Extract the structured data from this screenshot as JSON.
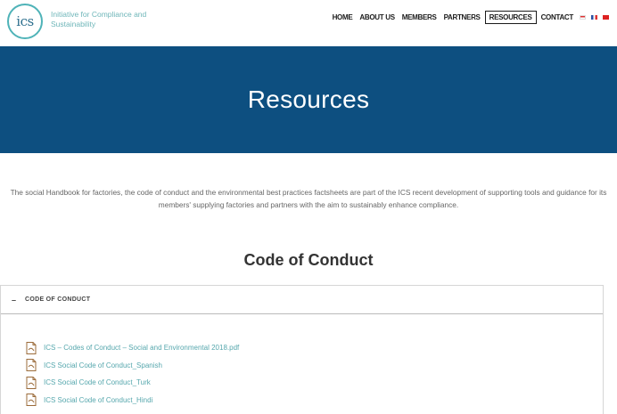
{
  "logo": {
    "text": "ics",
    "tagline": "Initiative for Compliance and Sustainability"
  },
  "nav": {
    "items": [
      {
        "label": "HOME"
      },
      {
        "label": "ABOUT US"
      },
      {
        "label": "MEMBERS"
      },
      {
        "label": "PARTNERS"
      },
      {
        "label": "RESOURCES",
        "active": true
      },
      {
        "label": "CONTACT"
      }
    ],
    "flags": [
      "flag-icon",
      "flag-icon",
      "flag-icon"
    ]
  },
  "banner": {
    "title": "Resources",
    "background": "#0d4f80"
  },
  "intro": {
    "text": "The social Handbook for factories, the code of conduct and the environmental best practices factsheets are part of the ICS recent development of supporting tools and guidance for its members' supplying factories and partners with the aim to sustainably enhance compliance."
  },
  "section": {
    "title": "Code of Conduct"
  },
  "accordion": {
    "toggle": "–",
    "label": "CODE OF CONDUCT",
    "files": [
      {
        "label": "ICS – Codes of Conduct – Social and Environmental 2018.pdf",
        "icon": "pdf-icon"
      },
      {
        "label": "ICS Social Code of Conduct_Spanish",
        "icon": "pdf-icon"
      },
      {
        "label": "ICS Social Code of Conduct_Turk",
        "icon": "pdf-icon"
      },
      {
        "label": "ICS Social Code of Conduct_Hindi",
        "icon": "pdf-icon"
      }
    ]
  },
  "colors": {
    "accent": "#4fb3b8",
    "link": "#56a7ad",
    "pdf_icon": "#9b6b3a"
  }
}
